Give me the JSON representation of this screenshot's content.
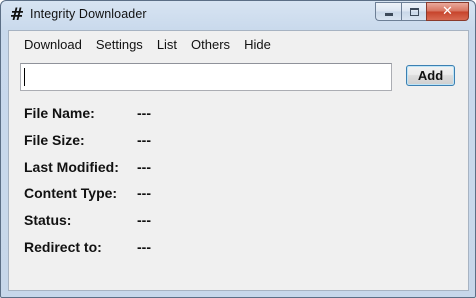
{
  "window": {
    "title": "Integrity Downloader",
    "icon": "hash-icon",
    "icon_glyph": "#",
    "controls": {
      "minimize": "minimize-icon",
      "maximize": "maximize-icon",
      "close": "close-icon",
      "close_glyph": "✕"
    }
  },
  "menu": {
    "items": [
      {
        "label": "Download"
      },
      {
        "label": "Settings"
      },
      {
        "label": "List"
      },
      {
        "label": "Others"
      },
      {
        "label": "Hide"
      }
    ]
  },
  "url_input": {
    "value": "",
    "placeholder": ""
  },
  "add_button": {
    "label": "Add"
  },
  "info": {
    "rows": [
      {
        "label": "File Name:",
        "value": "---"
      },
      {
        "label": "File Size:",
        "value": "---"
      },
      {
        "label": "Last Modified:",
        "value": "---"
      },
      {
        "label": "Content Type:",
        "value": "---"
      },
      {
        "label": "Status:",
        "value": "---"
      },
      {
        "label": "Redirect to:",
        "value": "---"
      }
    ]
  },
  "colors": {
    "title_bar": "#c9d9ec",
    "client_background": "#f0f0f0",
    "close_button": "#c7432b",
    "focus_border": "#3c7fb1"
  }
}
